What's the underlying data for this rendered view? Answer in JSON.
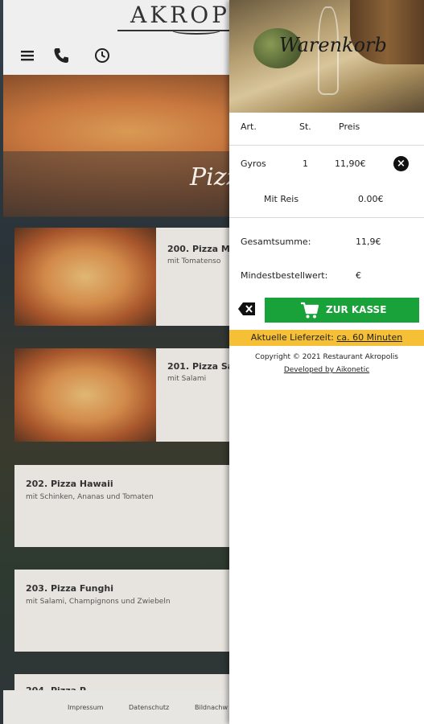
{
  "site": {
    "logo": "AKROP",
    "hero_title": "Pizz",
    "menu_items": [
      {
        "name": "200. Pizza M",
        "desc": "mit Tomatenso"
      },
      {
        "name": "201. Pizza Sa",
        "desc": "mit Salami"
      },
      {
        "name": "202. Pizza Hawaii",
        "desc": "mit Schinken, Ananas und Tomaten"
      },
      {
        "name": "203. Pizza Funghi",
        "desc": "mit Salami, Champignons und Zwiebeln"
      },
      {
        "name": "204. Pizza P",
        "desc": ""
      }
    ],
    "footer": [
      "Impressum",
      "Datenschutz",
      "Bildnachw"
    ]
  },
  "icons": {
    "menu": "hamburger-icon",
    "phone": "phone-icon",
    "clock": "clock-icon",
    "remove": "close-circle-icon",
    "clear": "backspace-icon",
    "cart": "shopping-cart-icon"
  },
  "colors": {
    "accent_green": "#1aa23a",
    "delivery_yellow": "#f5c035"
  },
  "cart": {
    "title": "Warenkorb",
    "headers": {
      "art": "Art.",
      "st": "St.",
      "preis": "Preis"
    },
    "items": [
      {
        "name": "Gyros",
        "qty": "1",
        "price": "11,90€"
      }
    ],
    "extra": {
      "name": "Mit Reis",
      "price": "0.00€"
    },
    "total_label": "Gesamtsumme:",
    "total_value": "11,9€",
    "min_label": "Mindestbestellwert:",
    "min_value": "€",
    "checkout_label": "ZUR KASSE",
    "delivery_prefix": "Aktuelle Lieferzeit:",
    "delivery_value": "ca. 60 Minuten",
    "copyright": "Copyright © 2021 Restaurant Akropolis",
    "developed": "Developed by Aikonetic"
  }
}
